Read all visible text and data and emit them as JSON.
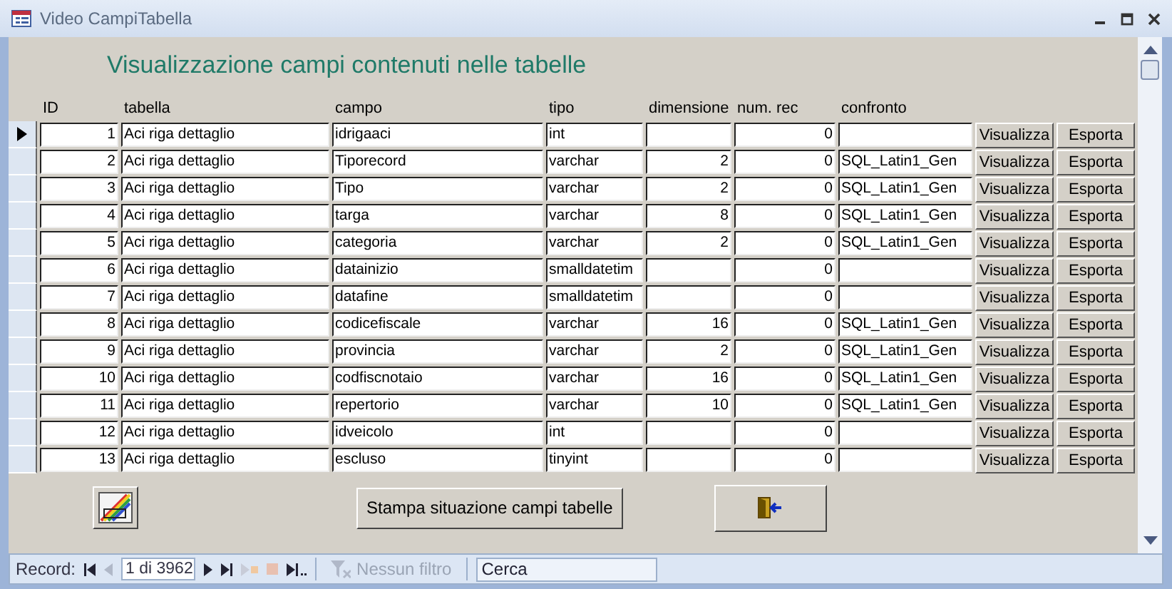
{
  "window": {
    "title": "Video CampiTabella"
  },
  "heading": "Visualizzazione campi contenuti nelle tabelle",
  "columns": [
    "ID",
    "tabella",
    "campo",
    "tipo",
    "dimensione",
    "num. rec",
    "confronto"
  ],
  "rows": [
    {
      "selected": true,
      "id": "1",
      "tabella": "Aci riga dettaglio",
      "campo": "idrigaaci",
      "tipo": "int",
      "dimensione": "",
      "num_rec": "0",
      "confronto": "",
      "actions": [
        "Visualizza",
        "Esporta"
      ]
    },
    {
      "selected": false,
      "id": "2",
      "tabella": "Aci riga dettaglio",
      "campo": "Tiporecord",
      "tipo": "varchar",
      "dimensione": "2",
      "num_rec": "0",
      "confronto": "SQL_Latin1_Gen",
      "actions": [
        "Visualizza",
        "Esporta"
      ]
    },
    {
      "selected": false,
      "id": "3",
      "tabella": "Aci riga dettaglio",
      "campo": "Tipo",
      "tipo": "varchar",
      "dimensione": "2",
      "num_rec": "0",
      "confronto": "SQL_Latin1_Gen",
      "actions": [
        "Visualizza",
        "Esporta"
      ]
    },
    {
      "selected": false,
      "id": "4",
      "tabella": "Aci riga dettaglio",
      "campo": "targa",
      "tipo": "varchar",
      "dimensione": "8",
      "num_rec": "0",
      "confronto": "SQL_Latin1_Gen",
      "actions": [
        "Visualizza",
        "Esporta"
      ]
    },
    {
      "selected": false,
      "id": "5",
      "tabella": "Aci riga dettaglio",
      "campo": "categoria",
      "tipo": "varchar",
      "dimensione": "2",
      "num_rec": "0",
      "confronto": "SQL_Latin1_Gen",
      "actions": [
        "Visualizza",
        "Esporta"
      ]
    },
    {
      "selected": false,
      "id": "6",
      "tabella": "Aci riga dettaglio",
      "campo": "datainizio",
      "tipo": "smalldatetim",
      "dimensione": "",
      "num_rec": "0",
      "confronto": "",
      "actions": [
        "Visualizza",
        "Esporta"
      ]
    },
    {
      "selected": false,
      "id": "7",
      "tabella": "Aci riga dettaglio",
      "campo": "datafine",
      "tipo": "smalldatetim",
      "dimensione": "",
      "num_rec": "0",
      "confronto": "",
      "actions": [
        "Visualizza",
        "Esporta"
      ]
    },
    {
      "selected": false,
      "id": "8",
      "tabella": "Aci riga dettaglio",
      "campo": "codicefiscale",
      "tipo": "varchar",
      "dimensione": "16",
      "num_rec": "0",
      "confronto": "SQL_Latin1_Gen",
      "actions": [
        "Visualizza",
        "Esporta"
      ]
    },
    {
      "selected": false,
      "id": "9",
      "tabella": "Aci riga dettaglio",
      "campo": "provincia",
      "tipo": "varchar",
      "dimensione": "2",
      "num_rec": "0",
      "confronto": "SQL_Latin1_Gen",
      "actions": [
        "Visualizza",
        "Esporta"
      ]
    },
    {
      "selected": false,
      "id": "10",
      "tabella": "Aci riga dettaglio",
      "campo": "codfiscnotaio",
      "tipo": "varchar",
      "dimensione": "16",
      "num_rec": "0",
      "confronto": "SQL_Latin1_Gen",
      "actions": [
        "Visualizza",
        "Esporta"
      ]
    },
    {
      "selected": false,
      "id": "11",
      "tabella": "Aci riga dettaglio",
      "campo": "repertorio",
      "tipo": "varchar",
      "dimensione": "10",
      "num_rec": "0",
      "confronto": "SQL_Latin1_Gen",
      "actions": [
        "Visualizza",
        "Esporta"
      ]
    },
    {
      "selected": false,
      "id": "12",
      "tabella": "Aci riga dettaglio",
      "campo": "idveicolo",
      "tipo": "int",
      "dimensione": "",
      "num_rec": "0",
      "confronto": "",
      "actions": [
        "Visualizza",
        "Esporta"
      ]
    },
    {
      "selected": false,
      "id": "13",
      "tabella": "Aci riga dettaglio",
      "campo": "escluso",
      "tipo": "tinyint",
      "dimensione": "",
      "num_rec": "0",
      "confronto": "",
      "actions": [
        "Visualizza",
        "Esporta"
      ]
    }
  ],
  "footer_buttons": {
    "print": "Stampa situazione campi tabelle"
  },
  "status_bar": {
    "record_label": "Record:",
    "position": "1 di 3962",
    "filter": {
      "label": "Nessun filtro",
      "disabled": true
    },
    "search": {
      "placeholder": "Cerca"
    }
  }
}
